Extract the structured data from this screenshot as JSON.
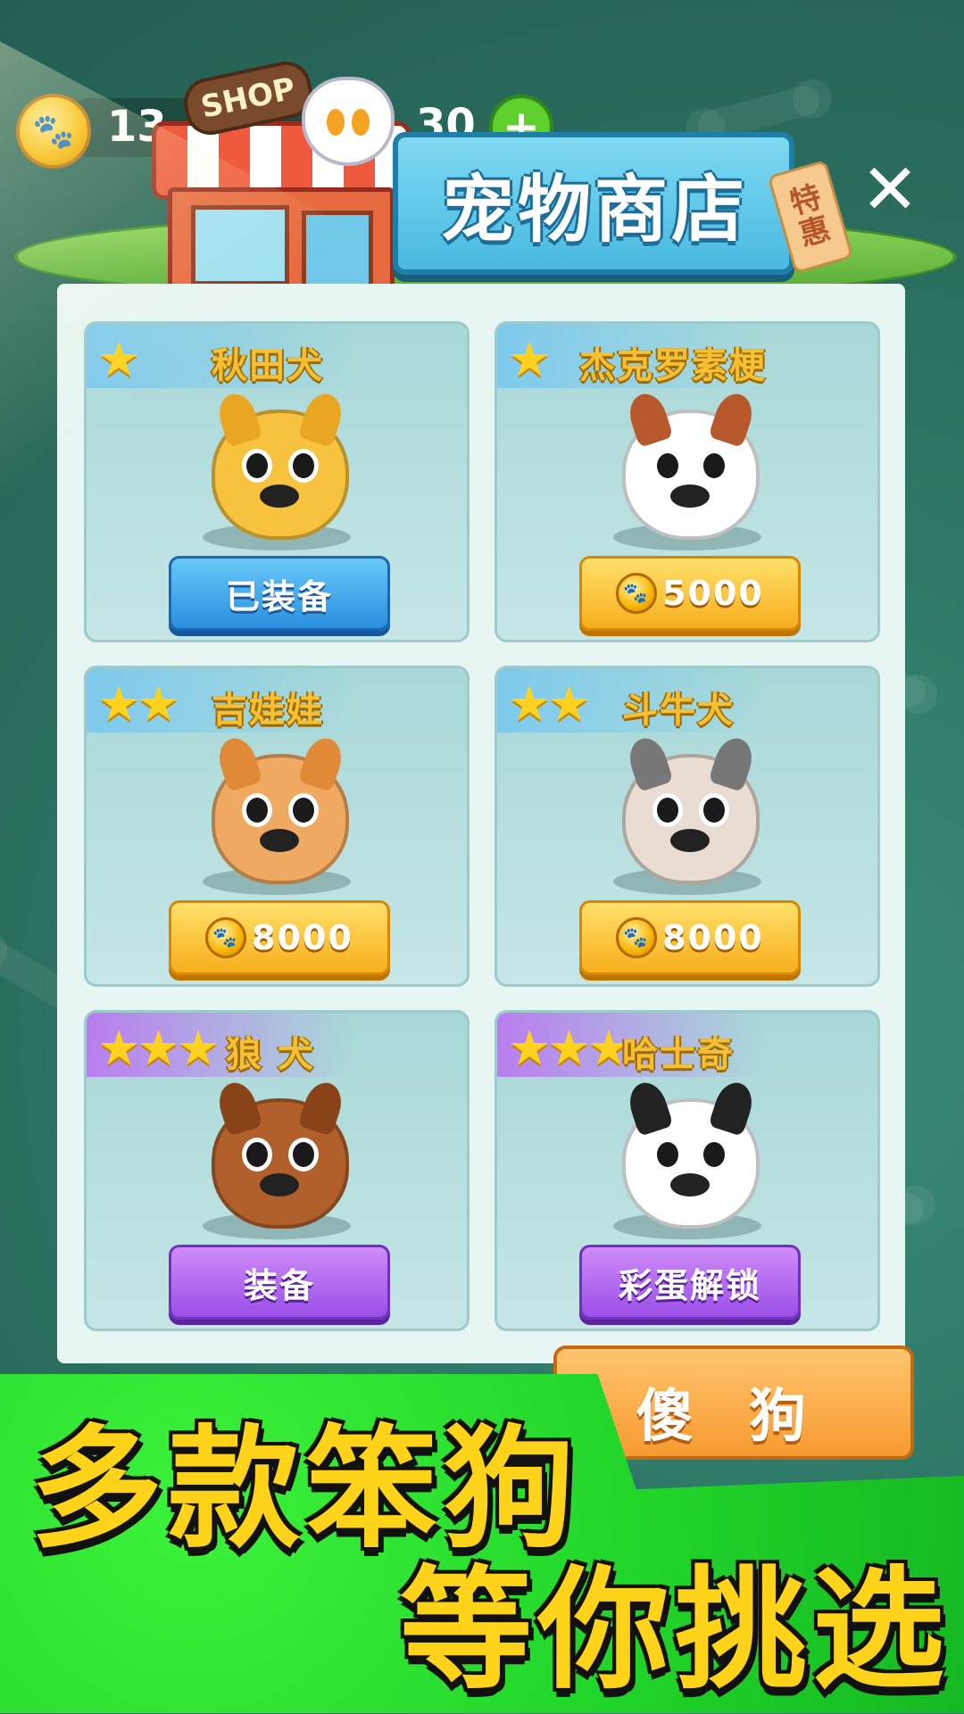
{
  "hud": {
    "coins": "13",
    "gems": "30",
    "plus": "+"
  },
  "header": {
    "title": "宠物商店",
    "tag_line1": "特",
    "tag_line2": "惠",
    "shop_sign": "SHOP",
    "close": "✕"
  },
  "cards": [
    {
      "stars": "★",
      "name": "秋田犬",
      "button": "已装备",
      "button_style": "blue",
      "body_color": "#f7c23d",
      "ear_color": "#e9a623"
    },
    {
      "stars": "★",
      "name": "杰克罗素梗",
      "button": "5000",
      "button_style": "gold",
      "body_color": "#ffffff",
      "ear_color": "#b8582d"
    },
    {
      "stars": "★★",
      "name": "吉娃娃",
      "button": "8000",
      "button_style": "gold",
      "body_color": "#f0a961",
      "ear_color": "#e08a37"
    },
    {
      "stars": "★★",
      "name": "斗牛犬",
      "button": "8000",
      "button_style": "gold",
      "body_color": "#e9dcd2",
      "ear_color": "#777777"
    },
    {
      "stars": "★★★",
      "name": "狼 犬",
      "button": "装备",
      "button_style": "purple",
      "body_color": "#b1602b",
      "ear_color": "#8a4218"
    },
    {
      "stars": "★★★",
      "name": "哈士奇",
      "button": "彩蛋解锁",
      "button_style": "purple",
      "body_color": "#ffffff",
      "ear_color": "#222222"
    }
  ],
  "bottom_bar": {
    "label": "傻 狗"
  },
  "promo": {
    "line1": "多款笨狗",
    "line2": "等你挑选"
  },
  "coin_icon": "🐾"
}
